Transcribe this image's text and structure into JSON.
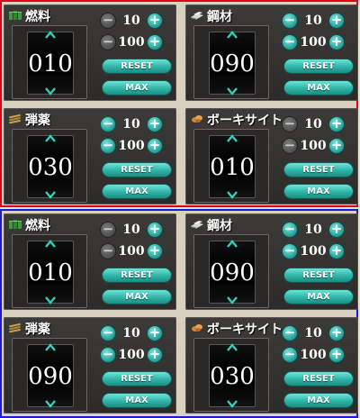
{
  "colors": {
    "top_group_border": "#e0001a",
    "bottom_group_border": "#1a1ad8",
    "accent_teal": "#2fb3a7",
    "panel_bg": "#2c2b29"
  },
  "groups": [
    {
      "panels": [
        {
          "name": "燃料",
          "icon": "fuel-icon",
          "value": "010",
          "minus10_enabled": false,
          "minus100_enabled": false,
          "row1_amount": "10",
          "row2_amount": "100",
          "reset_label": "RESET",
          "max_label": "MAX"
        },
        {
          "name": "鋼材",
          "icon": "steel-icon",
          "value": "090",
          "minus10_enabled": true,
          "minus100_enabled": true,
          "row1_amount": "10",
          "row2_amount": "100",
          "reset_label": "RESET",
          "max_label": "MAX"
        },
        {
          "name": "弾薬",
          "icon": "ammo-icon",
          "value": "030",
          "minus10_enabled": true,
          "minus100_enabled": true,
          "row1_amount": "10",
          "row2_amount": "100",
          "reset_label": "RESET",
          "max_label": "MAX"
        },
        {
          "name": "ボーキサイト",
          "icon": "bauxite-icon",
          "value": "010",
          "minus10_enabled": false,
          "minus100_enabled": false,
          "row1_amount": "10",
          "row2_amount": "100",
          "reset_label": "RESET",
          "max_label": "MAX"
        }
      ]
    },
    {
      "panels": [
        {
          "name": "燃料",
          "icon": "fuel-icon",
          "value": "010",
          "minus10_enabled": false,
          "minus100_enabled": false,
          "row1_amount": "10",
          "row2_amount": "100",
          "reset_label": "RESET",
          "max_label": "MAX"
        },
        {
          "name": "鋼材",
          "icon": "steel-icon",
          "value": "090",
          "minus10_enabled": true,
          "minus100_enabled": true,
          "row1_amount": "10",
          "row2_amount": "100",
          "reset_label": "RESET",
          "max_label": "MAX"
        },
        {
          "name": "弾薬",
          "icon": "ammo-icon",
          "value": "090",
          "minus10_enabled": true,
          "minus100_enabled": true,
          "row1_amount": "10",
          "row2_amount": "100",
          "reset_label": "RESET",
          "max_label": "MAX"
        },
        {
          "name": "ボーキサイト",
          "icon": "bauxite-icon",
          "value": "030",
          "minus10_enabled": true,
          "minus100_enabled": true,
          "row1_amount": "10",
          "row2_amount": "100",
          "reset_label": "RESET",
          "max_label": "MAX"
        }
      ]
    }
  ]
}
